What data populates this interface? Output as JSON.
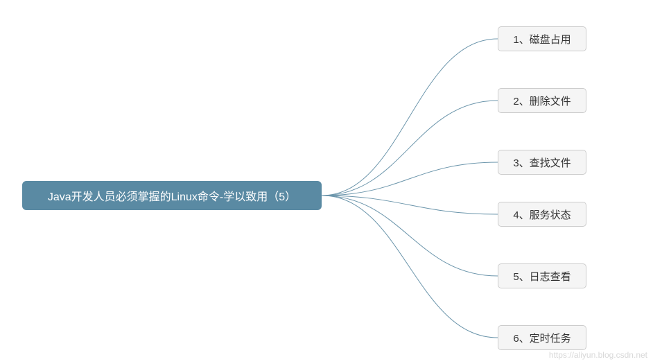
{
  "central": {
    "label": "Java开发人员必须掌握的Linux命令-学以致用（5）"
  },
  "children": [
    {
      "label": "1、磁盘占用"
    },
    {
      "label": "2、删除文件"
    },
    {
      "label": "3、查找文件"
    },
    {
      "label": "4、服务状态"
    },
    {
      "label": "5、日志查看"
    },
    {
      "label": "6、定时任务"
    }
  ],
  "watermark": "https://aliyun.blog.csdn.net"
}
